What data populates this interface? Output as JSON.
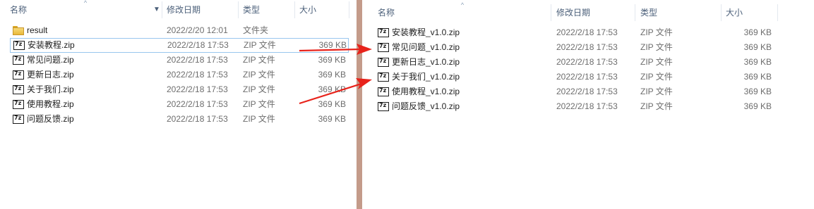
{
  "left": {
    "headers": {
      "name": "名称",
      "date": "修改日期",
      "type": "类型",
      "size": "大小"
    },
    "rows": [
      {
        "name": "result",
        "date": "2022/2/20 12:01",
        "type": "文件夹",
        "size": "",
        "icon": "folder-icon"
      },
      {
        "name": "安装教程.zip",
        "date": "2022/2/18 17:53",
        "type": "ZIP 文件",
        "size": "369 KB",
        "icon": "zip-icon",
        "selected": true
      },
      {
        "name": "常见问题.zip",
        "date": "2022/2/18 17:53",
        "type": "ZIP 文件",
        "size": "369 KB",
        "icon": "zip-icon"
      },
      {
        "name": "更新日志.zip",
        "date": "2022/2/18 17:53",
        "type": "ZIP 文件",
        "size": "369 KB",
        "icon": "zip-icon"
      },
      {
        "name": "关于我们.zip",
        "date": "2022/2/18 17:53",
        "type": "ZIP 文件",
        "size": "369 KB",
        "icon": "zip-icon"
      },
      {
        "name": "使用教程.zip",
        "date": "2022/2/18 17:53",
        "type": "ZIP 文件",
        "size": "369 KB",
        "icon": "zip-icon"
      },
      {
        "name": "问题反馈.zip",
        "date": "2022/2/18 17:53",
        "type": "ZIP 文件",
        "size": "369 KB",
        "icon": "zip-icon"
      }
    ]
  },
  "right": {
    "headers": {
      "name": "名称",
      "date": "修改日期",
      "type": "类型",
      "size": "大小"
    },
    "rows": [
      {
        "name": "安装教程_v1.0.zip",
        "date": "2022/2/18 17:53",
        "type": "ZIP 文件",
        "size": "369 KB",
        "icon": "zip-icon"
      },
      {
        "name": "常见问题_v1.0.zip",
        "date": "2022/2/18 17:53",
        "type": "ZIP 文件",
        "size": "369 KB",
        "icon": "zip-icon"
      },
      {
        "name": "更新日志_v1.0.zip",
        "date": "2022/2/18 17:53",
        "type": "ZIP 文件",
        "size": "369 KB",
        "icon": "zip-icon"
      },
      {
        "name": "关于我们_v1.0.zip",
        "date": "2022/2/18 17:53",
        "type": "ZIP 文件",
        "size": "369 KB",
        "icon": "zip-icon"
      },
      {
        "name": "使用教程_v1.0.zip",
        "date": "2022/2/18 17:53",
        "type": "ZIP 文件",
        "size": "369 KB",
        "icon": "zip-icon"
      },
      {
        "name": "问题反馈_v1.0.zip",
        "date": "2022/2/18 17:53",
        "type": "ZIP 文件",
        "size": "369 KB",
        "icon": "zip-icon"
      }
    ]
  },
  "colors": {
    "arrow": "#e8231b",
    "divider": "#c49b8a",
    "selection_border": "#99c6ee",
    "header_text": "#4c607a"
  },
  "annotation_icons": [
    "red-arrow-icon",
    "red-arrow-icon"
  ]
}
